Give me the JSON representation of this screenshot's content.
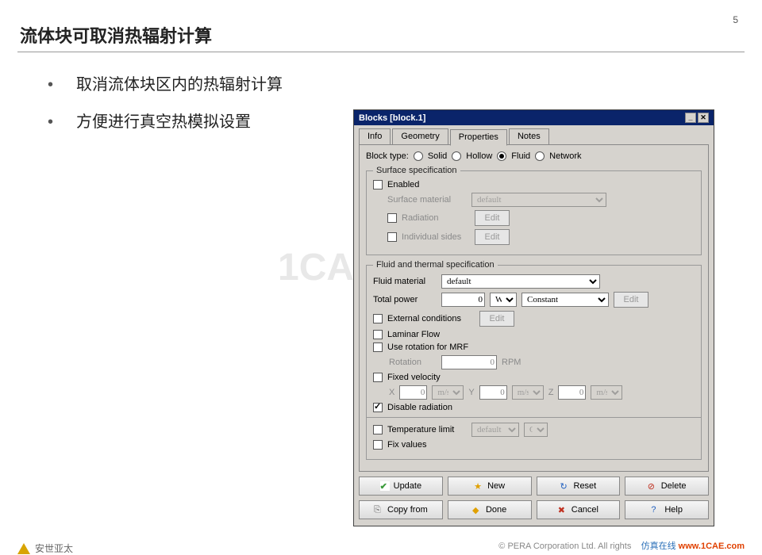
{
  "slide": {
    "title": "流体块可取消热辐射计算",
    "page_number": "5",
    "bullets": [
      "取消流体块区内的热辐射计算",
      "方便进行真空热模拟设置"
    ],
    "watermark": "1CAE",
    "footer_left": "安世亚太",
    "footer_right_prefix": "仿真在线",
    "footer_right_url": "www.1CAE.com",
    "copyright": "©   PERA Corporation Ltd.   All rights"
  },
  "dialog": {
    "title": "Blocks [block.1]",
    "tabs": [
      "Info",
      "Geometry",
      "Properties",
      "Notes"
    ],
    "active_tab": "Properties",
    "block_type_label": "Block type:",
    "block_types": [
      "Solid",
      "Hollow",
      "Fluid",
      "Network"
    ],
    "block_type_selected": "Fluid",
    "surface_spec": {
      "legend": "Surface specification",
      "enabled_label": "Enabled",
      "surface_material_label": "Surface material",
      "surface_material_value": "default",
      "radiation_label": "Radiation",
      "individual_label": "Individual sides",
      "edit_label": "Edit"
    },
    "fluid_spec": {
      "legend": "Fluid and thermal specification",
      "fluid_material_label": "Fluid material",
      "fluid_material_value": "default",
      "total_power_label": "Total power",
      "total_power_value": "0",
      "total_power_unit": "W",
      "power_mode": "Constant",
      "edit_label": "Edit",
      "external_conditions_label": "External conditions",
      "laminar_label": "Laminar Flow",
      "mrf_label": "Use rotation for MRF",
      "rotation_label": "Rotation",
      "rotation_value": "0",
      "rotation_unit": "RPM",
      "fixed_velocity_label": "Fixed velocity",
      "fv_x_label": "X",
      "fv_y_label": "Y",
      "fv_z_label": "Z",
      "fv_val": "0",
      "fv_unit": "m/s",
      "disable_radiation_label": "Disable radiation",
      "temp_limit_label": "Temperature limit",
      "temp_limit_value": "default",
      "temp_limit_unit": "C",
      "fix_values_label": "Fix values"
    },
    "buttons": {
      "update": "Update",
      "new": "New",
      "reset": "Reset",
      "delete": "Delete",
      "copy": "Copy from",
      "done": "Done",
      "cancel": "Cancel",
      "help": "Help"
    }
  }
}
